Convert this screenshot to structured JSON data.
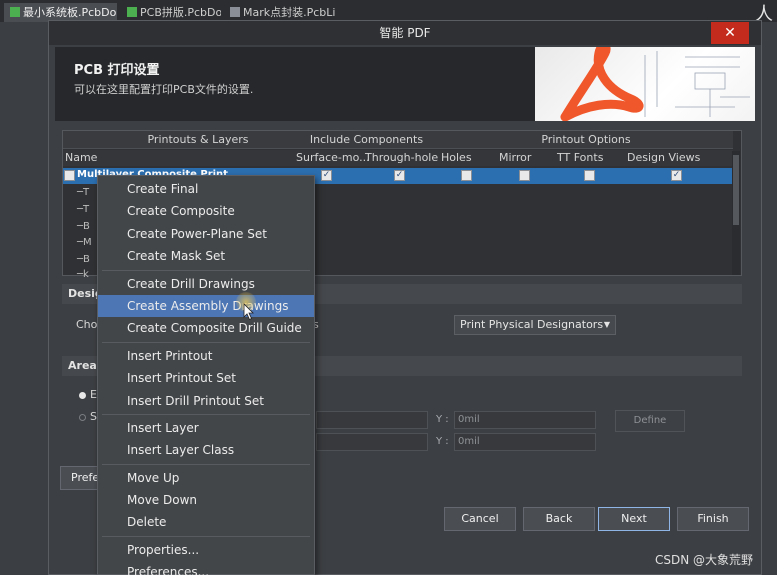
{
  "editor_tabs": [
    {
      "label": "最小系统板.PcbDoc",
      "active": true
    },
    {
      "label": "PCB拼版.PcbDoc",
      "active": false
    },
    {
      "label": "Mark点封装.PcbLib",
      "active": false
    }
  ],
  "dialog": {
    "title": "智能 PDF",
    "close_label": "✕",
    "banner_title": "PCB 打印设置",
    "banner_subtitle": "可以在这里配置打印PCB文件的设置."
  },
  "grid": {
    "groups": [
      "Printouts & Layers",
      "Include Components",
      "Printout Options"
    ],
    "columns": [
      "Name",
      "Surface-mo...",
      "Through-hole",
      "Holes",
      "Mirror",
      "TT Fonts",
      "Design Views"
    ],
    "selected_row": {
      "name": "Multilayer Composite Print",
      "checks": [
        true,
        true,
        false,
        false,
        false,
        true
      ]
    },
    "tree_rows": [
      "T",
      "T",
      "B",
      "M",
      "B",
      "k"
    ]
  },
  "designator": {
    "section_partial": "Desig",
    "choose_partial": "Cho",
    "choose_tail": "s",
    "select_value": "Print Physical Designators"
  },
  "area": {
    "section_partial": "Area",
    "radio1_partial": "E",
    "radio2_partial": "Sp",
    "y_label": "Y :",
    "field_value": "0mil",
    "define_label": "Define"
  },
  "prefs_partial": "Prefe",
  "buttons": {
    "cancel": "Cancel",
    "back": "Back",
    "next": "Next",
    "finish": "Finish"
  },
  "context_menu": {
    "groups": [
      [
        "Create Final",
        "Create Composite",
        "Create Power-Plane Set",
        "Create Mask Set"
      ],
      [
        "Create Drill Drawings",
        "Create Assembly Drawings",
        "Create Composite Drill Guide"
      ],
      [
        "Insert Printout",
        "Insert Printout Set",
        "Insert Drill Printout Set"
      ],
      [
        "Insert Layer",
        "Insert Layer Class"
      ],
      [
        "Move Up",
        "Move Down",
        "Delete"
      ],
      [
        "Properties...",
        "Preferences..."
      ]
    ],
    "highlighted": "Create Assembly Drawings"
  },
  "corner_glyph": "人",
  "watermark": "CSDN @大象荒野",
  "colors": {
    "selection": "#2c6fb0",
    "menu_highlight": "#4d76b4",
    "close_button": "#c42b1c",
    "pdf_logo": "#f0572a"
  }
}
